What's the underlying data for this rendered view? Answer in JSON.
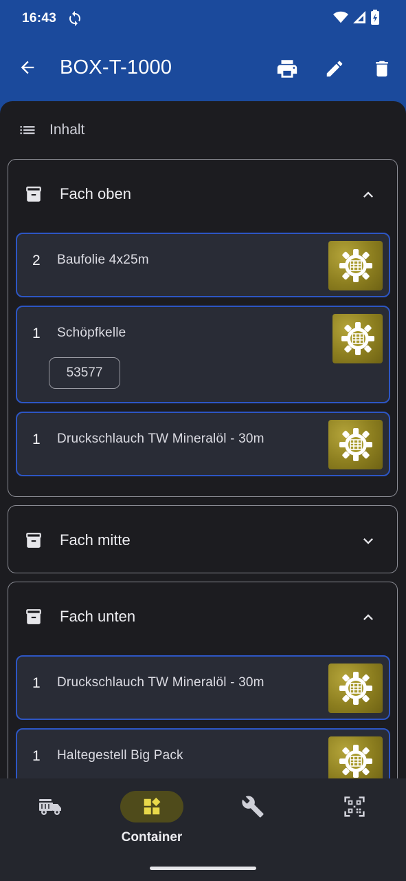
{
  "status": {
    "time": "16:43"
  },
  "app_bar": {
    "title": "BOX-T-1000"
  },
  "section": {
    "label": "Inhalt"
  },
  "compartments": [
    {
      "title": "Fach oben",
      "expanded": true,
      "items": [
        {
          "qty": "2",
          "name": "Baufolie 4x25m"
        },
        {
          "qty": "1",
          "name": "Schöpfkelle",
          "tag": "53577"
        },
        {
          "qty": "1",
          "name": "Druckschlauch TW Mineralöl - 30m"
        }
      ]
    },
    {
      "title": "Fach mitte",
      "expanded": false,
      "items": []
    },
    {
      "title": "Fach unten",
      "expanded": true,
      "items": [
        {
          "qty": "1",
          "name": "Druckschlauch TW Mineralöl - 30m"
        },
        {
          "qty": "1",
          "name": "Haltegestell Big Pack"
        }
      ]
    }
  ],
  "bottom_nav": {
    "items": [
      {
        "icon": "fire-truck-icon",
        "label": ""
      },
      {
        "icon": "container-icon",
        "label": "Container",
        "selected": true
      },
      {
        "icon": "wrench-icon",
        "label": ""
      },
      {
        "icon": "qr-scanner-icon",
        "label": ""
      }
    ]
  },
  "colors": {
    "app_bar": "#1b4a9c",
    "surface": "#1c1c20",
    "item_border": "#2d56c4",
    "nav_pill": "#4f4b1b",
    "nav_icon_active": "#e8d84a"
  }
}
